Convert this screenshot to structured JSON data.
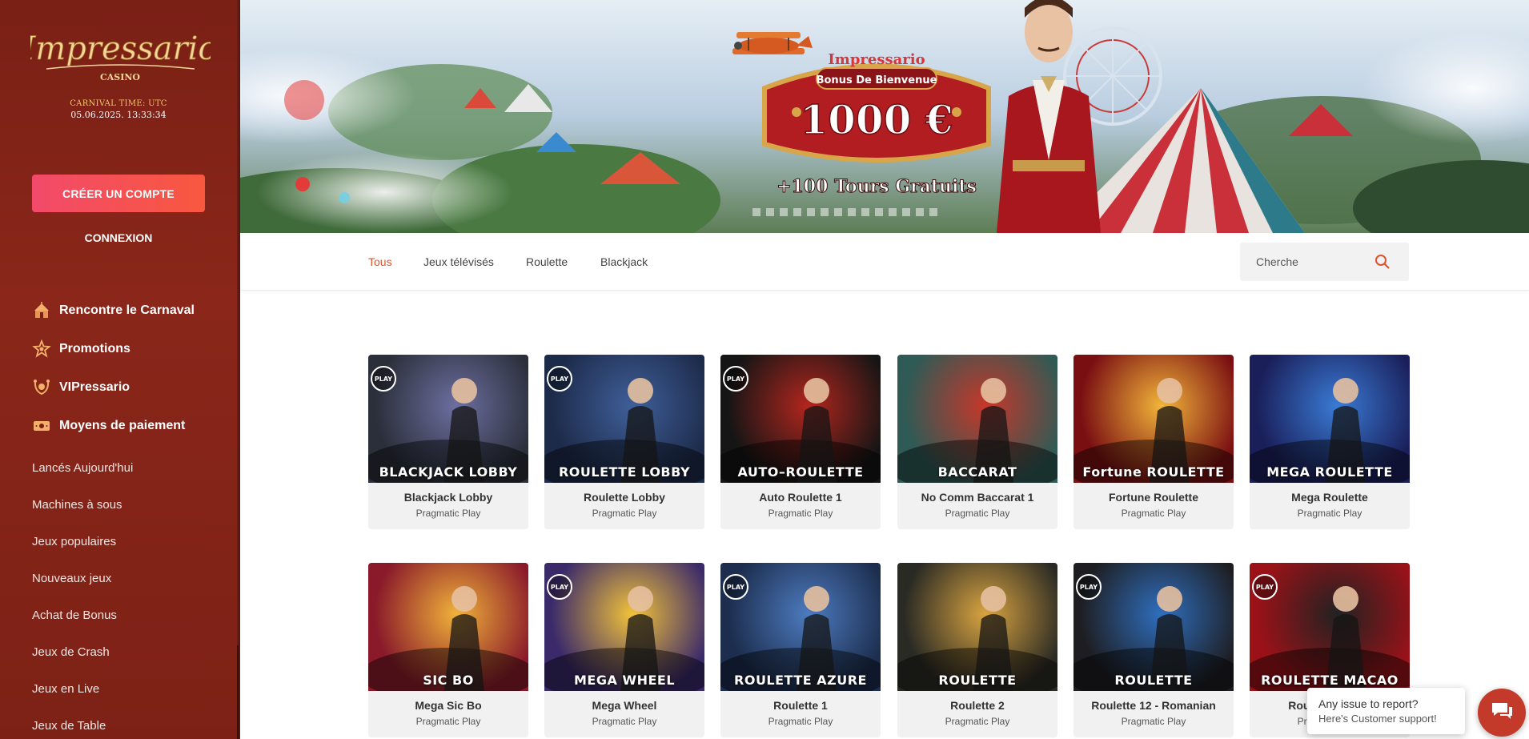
{
  "brand": {
    "logo_text": "Impressario",
    "logo_sub": "CASINO"
  },
  "clock": {
    "label": "CARNIVAL TIME: UTC",
    "time": "05.06.2025. 13:33:34"
  },
  "auth": {
    "create_account": "CRÉER UN COMPTE",
    "login": "CONNEXION"
  },
  "sidebar": {
    "main": [
      {
        "label": "Rencontre le Carnaval",
        "icon": "tent-icon"
      },
      {
        "label": "Promotions",
        "icon": "star-badge-icon"
      },
      {
        "label": "VIPressario",
        "icon": "vip-crown-icon"
      },
      {
        "label": "Moyens de paiement",
        "icon": "cash-icon"
      }
    ],
    "sub": [
      {
        "label": "Lancés Aujourd'hui"
      },
      {
        "label": "Machines à sous"
      },
      {
        "label": "Jeux populaires"
      },
      {
        "label": "Nouveaux jeux"
      },
      {
        "label": "Achat de Bonus"
      },
      {
        "label": "Jeux de Crash"
      },
      {
        "label": "Jeux en Live"
      },
      {
        "label": "Jeux de Table"
      }
    ]
  },
  "banner": {
    "brand": "Impressario",
    "ribbon": "Bonus De Bienvenue",
    "amount": "1000 €",
    "extra": "+100 Tours Gratuits"
  },
  "tabs": [
    {
      "label": "Tous",
      "active": true
    },
    {
      "label": "Jeux télévisés",
      "active": false
    },
    {
      "label": "Roulette",
      "active": false
    },
    {
      "label": "Blackjack",
      "active": false
    }
  ],
  "search": {
    "placeholder": "Cherche"
  },
  "games": [
    {
      "name": "Blackjack Lobby",
      "provider": "Pragmatic Play",
      "thumb_label": "BLACKJACK LOBBY",
      "play_badge": "PLAY",
      "bg": "#2b2f3a",
      "accent": "#6c6fa0"
    },
    {
      "name": "Roulette Lobby",
      "provider": "Pragmatic Play",
      "thumb_label": "ROULETTE LOBBY",
      "play_badge": "PLAY",
      "bg": "#1d2b4a",
      "accent": "#3f5f9a"
    },
    {
      "name": "Auto Roulette 1",
      "provider": "Pragmatic Play",
      "thumb_label": "AUTO–ROULETTE",
      "play_badge": "PLAY",
      "bg": "#151515",
      "accent": "#b3261e"
    },
    {
      "name": "No Comm Baccarat 1",
      "provider": "Pragmatic Play",
      "thumb_label": "BACCARAT",
      "play_badge": "",
      "bg": "#2f5a55",
      "accent": "#c7372a"
    },
    {
      "name": "Fortune Roulette",
      "provider": "Pragmatic Play",
      "thumb_label": "Fortune ROULETTE",
      "play_badge": "",
      "bg": "#7a0f12",
      "accent": "#f2b53a"
    },
    {
      "name": "Mega Roulette",
      "provider": "Pragmatic Play",
      "thumb_label": "MEGA ROULETTE",
      "play_badge": "",
      "bg": "#1a1f5a",
      "accent": "#3a7bd5"
    },
    {
      "name": "Mega Sic Bo",
      "provider": "Pragmatic Play",
      "thumb_label": "SIC BO",
      "play_badge": "",
      "bg": "#8a1a2a",
      "accent": "#f0b23a"
    },
    {
      "name": "Mega Wheel",
      "provider": "Pragmatic Play",
      "thumb_label": "MEGA WHEEL",
      "play_badge": "PLAY",
      "bg": "#3a2a6a",
      "accent": "#f2c23a"
    },
    {
      "name": "Roulette 1",
      "provider": "Pragmatic Play",
      "thumb_label": "ROULETTE AZURE",
      "play_badge": "PLAY",
      "bg": "#1c2d4d",
      "accent": "#4d7bc0"
    },
    {
      "name": "Roulette 2",
      "provider": "Pragmatic Play",
      "thumb_label": "ROULETTE",
      "play_badge": "",
      "bg": "#2a2a24",
      "accent": "#d9a441"
    },
    {
      "name": "Roulette 12 - Romanian",
      "provider": "Pragmatic Play",
      "thumb_label": "ROULETTE",
      "play_badge": "PLAY",
      "bg": "#1e1e22",
      "accent": "#2f6fbf"
    },
    {
      "name": "Roulette Macao",
      "provider": "Pragmatic Play",
      "thumb_label": "ROULETTE MACAO",
      "play_badge": "PLAY",
      "bg": "#9a1218",
      "accent": "#222222"
    }
  ],
  "support": {
    "line1": "Any issue to report?",
    "line2": "Here's Customer support!"
  },
  "colors": {
    "sidebar": "#8a261a",
    "cta": "#f24a6a",
    "active_tab": "#e0522b"
  }
}
